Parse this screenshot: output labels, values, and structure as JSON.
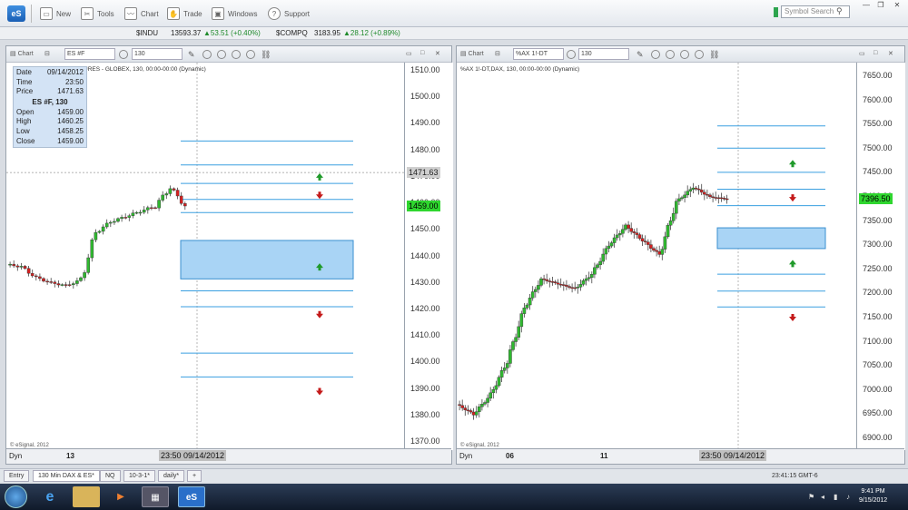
{
  "toolbar": {
    "new": "New",
    "tools": "Tools",
    "chart": "Chart",
    "trade": "Trade",
    "windows": "Windows",
    "support": "Support",
    "search_placeholder": "Symbol Search"
  },
  "ticker": {
    "s1": "$INDU",
    "v1": "13593.37",
    "c1": "▲53.51 (+0.40%)",
    "s2": "$COMPQ",
    "v2": "3183.95",
    "c2": "▲28.12 (+0.89%)"
  },
  "left": {
    "title": "Chart",
    "symbol": "ES #F",
    "interval": "130",
    "desc": "URES - GLOBEX, 130, 00:00-00:00 (Dynamic)",
    "info": {
      "date_l": "Date",
      "date": "09/14/2012",
      "time_l": "Time",
      "time": "23:50",
      "price_l": "Price",
      "price": "1471.63",
      "head": "ES #F, 130",
      "open_l": "Open",
      "open": "1459.00",
      "high_l": "High",
      "high": "1460.25",
      "low_l": "Low",
      "low": "1458.25",
      "close_l": "Close",
      "close": "1459.00"
    },
    "y_labels": [
      "1510.00",
      "1500.00",
      "1490.00",
      "1480.00",
      "1470.00",
      "1460.00",
      "1450.00",
      "1440.00",
      "1430.00",
      "1420.00",
      "1410.00",
      "1400.00",
      "1390.00",
      "1380.00",
      "1370.00"
    ],
    "cross_price": "1471.63",
    "last_price": "1459.00",
    "x_label": "13",
    "x_cursor": "23:50 09/14/2012",
    "copyright": "© eSignal, 2012",
    "dyn": "Dyn"
  },
  "right": {
    "title": "Chart",
    "symbol": "%AX 1!-DT",
    "interval": "130",
    "desc": "%AX 1!-DT,DAX, 130, 00:00-00:00 (Dynamic)",
    "y_labels": [
      "7650.00",
      "7600.00",
      "7550.00",
      "7500.00",
      "7450.00",
      "7400.00",
      "7350.00",
      "7300.00",
      "7250.00",
      "7200.00",
      "7150.00",
      "7100.00",
      "7050.00",
      "7000.00",
      "6950.00",
      "6900.00"
    ],
    "last_price": "7396.50",
    "x_label1": "06",
    "x_label2": "11",
    "x_cursor": "23:50 09/14/2012",
    "copyright": "© eSignal, 2012",
    "dyn": "Dyn"
  },
  "tabs": [
    "Entry",
    "130 Min DAX & ES*",
    "NQ",
    "10-3-1*",
    "daily*",
    "+"
  ],
  "status_time": "23:41:15 GMT-6",
  "clock": {
    "time": "9:41 PM",
    "date": "9/15/2012"
  },
  "colors": {
    "up": "#2fb82f",
    "down": "#d42020",
    "level": "#3a9fe0",
    "zone": "#a9d4f5"
  },
  "chart_data": [
    {
      "type": "candlestick",
      "symbol": "ES #F",
      "interval": "130",
      "ylim": [
        1366,
        1515
      ],
      "last": 1459.0,
      "levels": [
        1483.5,
        1474.5,
        1467.5,
        1461.5,
        1456.5,
        1427,
        1421,
        1403.5,
        1394.5
      ],
      "zone": [
        1431.5,
        1446
      ],
      "arrows_up": [
        1470,
        1436
      ],
      "arrows_down": [
        1463,
        1418,
        1389
      ]
    },
    {
      "type": "candlestick",
      "symbol": "%AX 1!-DT",
      "interval": "130",
      "ylim": [
        6890,
        7670
      ],
      "last": 7396.5,
      "levels": [
        7547,
        7501,
        7451,
        7416,
        7382,
        7240,
        7205,
        7172
      ],
      "zone": [
        7293,
        7336
      ],
      "arrows_up": [
        7469,
        7262
      ],
      "arrows_down": [
        7398,
        7150
      ]
    }
  ]
}
